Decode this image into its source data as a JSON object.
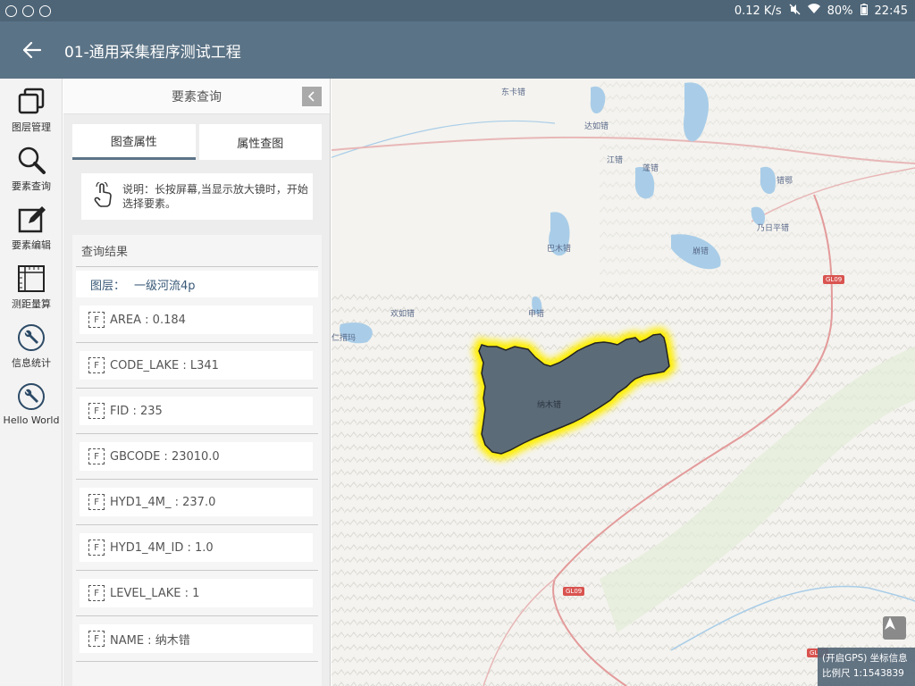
{
  "status_bar": {
    "speed": "0.12 K/s",
    "battery": "80%",
    "time": "22:45"
  },
  "app_bar": {
    "title": "01-通用采集程序测试工程"
  },
  "toolbar": {
    "items": [
      {
        "label": "图层管理",
        "icon": "layers-icon"
      },
      {
        "label": "要素查询",
        "icon": "magnifier-icon"
      },
      {
        "label": "要素编辑",
        "icon": "edit-icon"
      },
      {
        "label": "测距量算",
        "icon": "ruler-icon"
      },
      {
        "label": "信息统计",
        "icon": "wrench-icon"
      },
      {
        "label": "Hello World",
        "icon": "wrench-icon"
      }
    ]
  },
  "panel": {
    "title": "要素查询",
    "tabs": [
      {
        "label": "图查属性",
        "active": true
      },
      {
        "label": "属性查图",
        "active": false
      }
    ],
    "hint": "说明：长按屏幕,当显示放大镜时，开始选择要素。",
    "results_title": "查询结果",
    "layer_label": "图层：",
    "layer_value": "一级河流4p",
    "attributes": [
      "AREA : 0.184",
      "CODE_LAKE : L341",
      "FID : 235",
      "GBCODE : 23010.0",
      "HYD1_4M_ : 237.0",
      "HYD1_4M_ID : 1.0",
      "LEVEL_LAKE : 1",
      "NAME : 纳木错"
    ]
  },
  "map": {
    "labels": {
      "l1": "东卡错",
      "l2": "达如错",
      "l3": "江错",
      "l4": "蓬错",
      "l5": "错鄂",
      "l6": "乃日平错",
      "l7": "巴木错",
      "l8": "崩错",
      "l9": "申错",
      "l10": "欢如错",
      "l11": "仁措玛",
      "l12": "纳木错"
    },
    "road_1": "GL09",
    "road_2": "GL09",
    "road_3": "GL09",
    "gps_info": "(开启GPS) 坐标信息",
    "scale": "比例尺 1:1543839",
    "selection_color": "#ffee00",
    "lake_fill": "#5c6b78"
  }
}
